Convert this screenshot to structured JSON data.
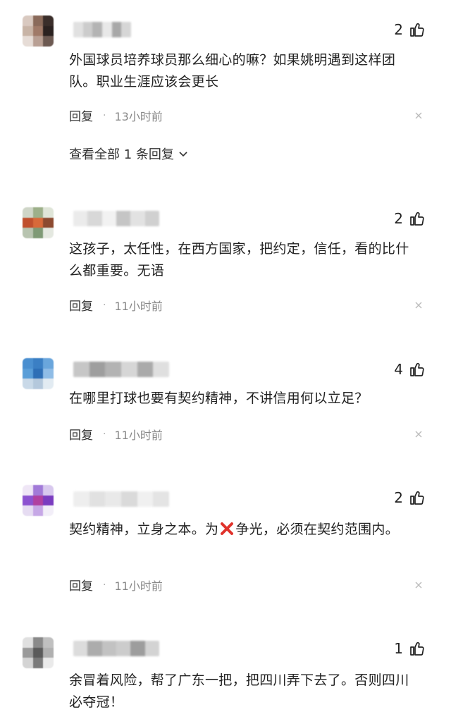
{
  "comments": [
    {
      "likes": "2",
      "text": "外国球员培养球员那么细心的嘛？如果姚明遇到这样团队。职业生涯应该会更长",
      "reply_label": "回复",
      "time": "13小时前",
      "view_replies": "查看全部 1 条回复",
      "avatar_colors": [
        "#d9c9c0",
        "#8a6a5a",
        "#3a2e2a",
        "#c8b4a6",
        "#a07a68",
        "#2b2220",
        "#e6dcd6",
        "#b9a094",
        "#6d5a52"
      ],
      "name_colors": [
        "#dcdcdc",
        "#c4c4c4",
        "#a8a8a8",
        "#e4e4e4",
        "#9a9a9a",
        "#d0d0d0"
      ]
    },
    {
      "likes": "2",
      "text": "这孩子，太任性，在西方国家，把约定，信任，看的比什么都重要。无语",
      "reply_label": "回复",
      "time": "11小时前",
      "avatar_colors": [
        "#cfd6c8",
        "#9db08a",
        "#dfe5d8",
        "#c0502e",
        "#d86a3a",
        "#8c4a30",
        "#b8c4b0",
        "#7f9a76",
        "#e4e8e0"
      ],
      "name_colors": [
        "#e8e8e8",
        "#d2d2d2",
        "#f0f0f0",
        "#bcbcbc",
        "#dedede",
        "#c8c8c8"
      ]
    },
    {
      "likes": "4",
      "text": "在哪里打球也要有契约精神，不讲信用何以立足？",
      "reply_label": "回复",
      "time": "11小时前",
      "avatar_colors": [
        "#4a8fd0",
        "#3b7fc4",
        "#6aa6dc",
        "#5a9ed8",
        "#2e6fb6",
        "#8fbce6",
        "#c9d9e8",
        "#b4c8dc",
        "#e2ebf2"
      ],
      "name_colors": [
        "#bdbdbd",
        "#8e8e8e",
        "#a6a6a6",
        "#cfcfcf",
        "#9c9c9c",
        "#dadada"
      ]
    },
    {
      "likes": "2",
      "text": "契约精神，立身之本。为",
      "text_after": "争光，必须在契约范围内。",
      "reply_label": "回复",
      "time": "11小时前",
      "avatar_colors": [
        "#efe6f6",
        "#a27ad8",
        "#d8c8ee",
        "#8c52d0",
        "#b040a0",
        "#7a3cc0",
        "#e6dcf2",
        "#c6a8e6",
        "#f2eef8"
      ],
      "name_colors": [
        "#ececec",
        "#dcdcdc",
        "#e6e6e6",
        "#d4d4d4",
        "#eeeeee",
        "#e0e0e0"
      ]
    },
    {
      "likes": "1",
      "text": "余冒着风险，帮了广东一把，把四川弄下去了。否则四川必夺冠！",
      "avatar_colors": [
        "#e0e0e0",
        "#8a8a8a",
        "#c0c0c0",
        "#9a9a9a",
        "#5a5a5a",
        "#b0b0b0",
        "#d4d4d4",
        "#7a7a7a",
        "#eaeaea"
      ],
      "name_colors": [
        "#d6d6d6",
        "#9e9e9e",
        "#b8b8b8",
        "#c4c4c4",
        "#8c8c8c",
        "#cccccc"
      ]
    }
  ],
  "icons": {
    "thumb": "thumbs-up-icon",
    "close": "close-icon",
    "chevron": "chevron-down-icon",
    "cross_emoji": "red-cross-icon"
  },
  "colors": {
    "text": "#222222",
    "meta": "#888888",
    "emoji_red": "#e0322b"
  }
}
